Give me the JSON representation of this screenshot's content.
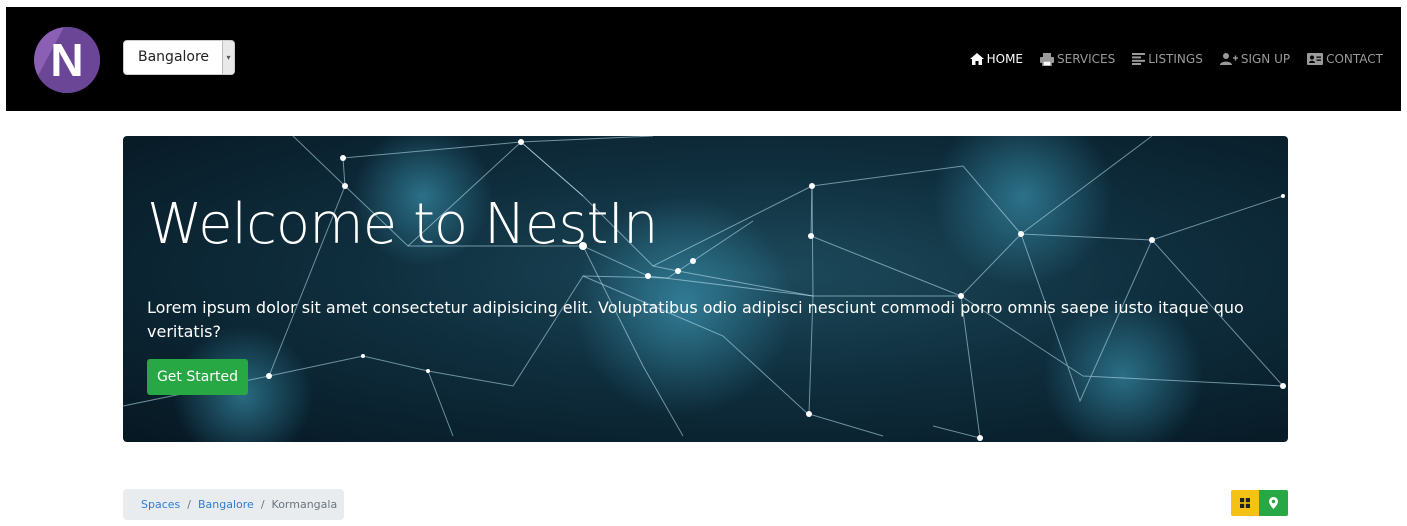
{
  "brand": {
    "logo_letter": "N",
    "logo_color": "#8a5fb4"
  },
  "location": {
    "selected_city": "Bangalore"
  },
  "nav": {
    "items": [
      {
        "label": "HOME",
        "icon": "home-icon",
        "active": true
      },
      {
        "label": "SERVICES",
        "icon": "printer-icon",
        "active": false
      },
      {
        "label": "LISTINGS",
        "icon": "list-icon",
        "active": false
      },
      {
        "label": "SIGN UP",
        "icon": "user-plus-icon",
        "active": false
      },
      {
        "label": "CONTACT",
        "icon": "address-card-icon",
        "active": false
      }
    ]
  },
  "hero": {
    "title": "Welcome to NestIn",
    "text": "Lorem ipsum dolor sit amet consectetur adipisicing elit. Voluptatibus odio adipisci nesciunt commodi porro omnis saepe iusto itaque quo veritatis?",
    "cta_label": "Get Started"
  },
  "breadcrumb": {
    "items": [
      "Spaces",
      "Bangalore",
      "Kormangala"
    ]
  },
  "view_toggle": {
    "grid_icon": "grid-icon",
    "map_icon": "map-marker-icon"
  },
  "colors": {
    "accent_green": "#28a745",
    "accent_yellow": "#f6c115",
    "link_blue": "#2e7cd6",
    "navbar_bg": "#000000"
  }
}
